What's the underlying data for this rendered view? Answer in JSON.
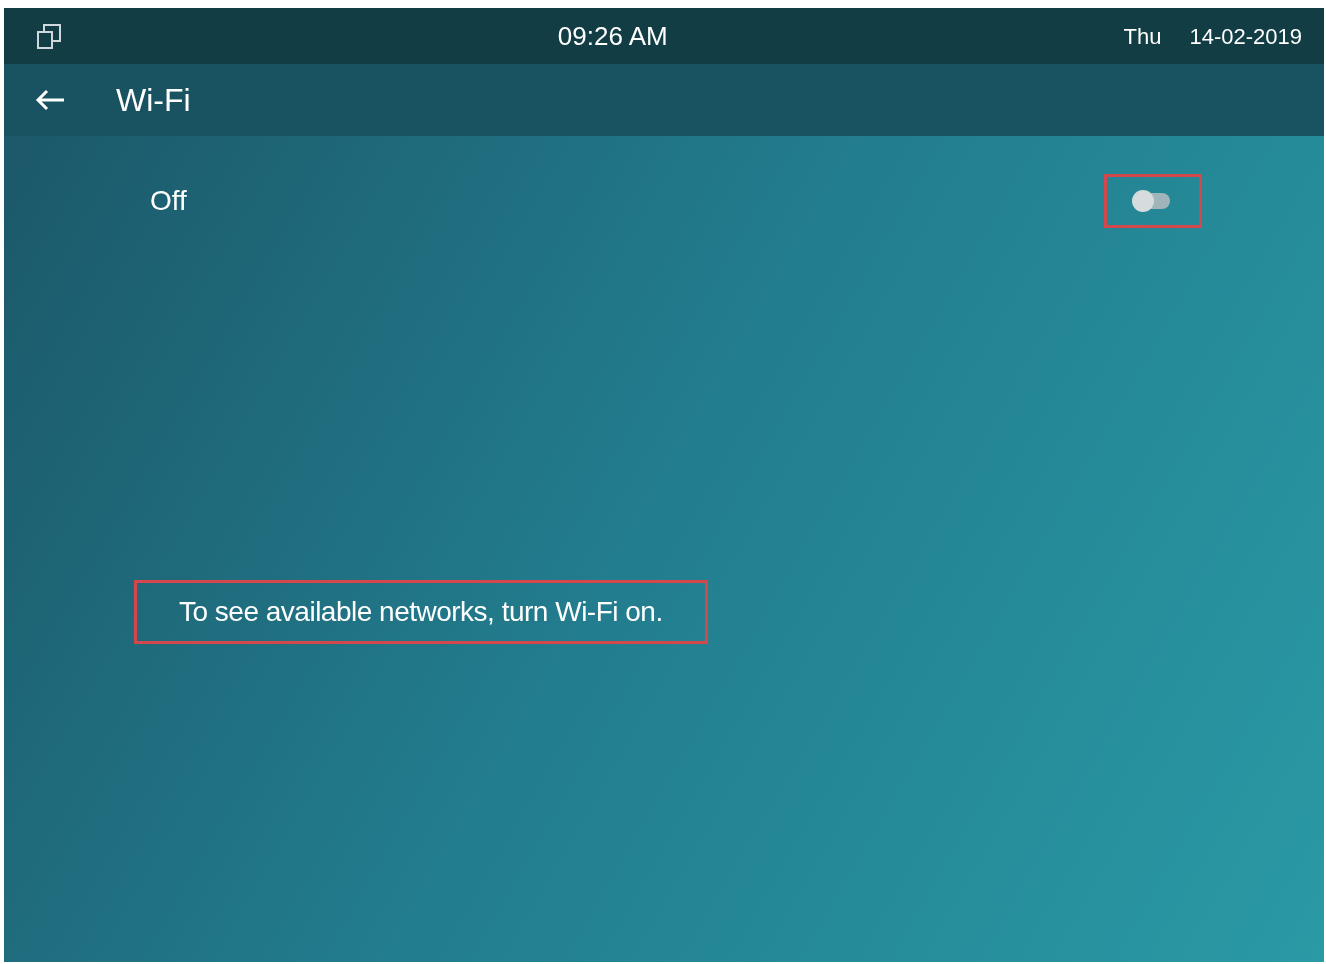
{
  "status_bar": {
    "time": "09:26 AM",
    "day": "Thu",
    "date": "14-02-2019"
  },
  "header": {
    "title": "Wi-Fi"
  },
  "wifi": {
    "label": "Off",
    "on": false,
    "highlighted": true
  },
  "message": {
    "text": "To see available networks, turn Wi-Fi on.",
    "highlighted": true
  }
}
